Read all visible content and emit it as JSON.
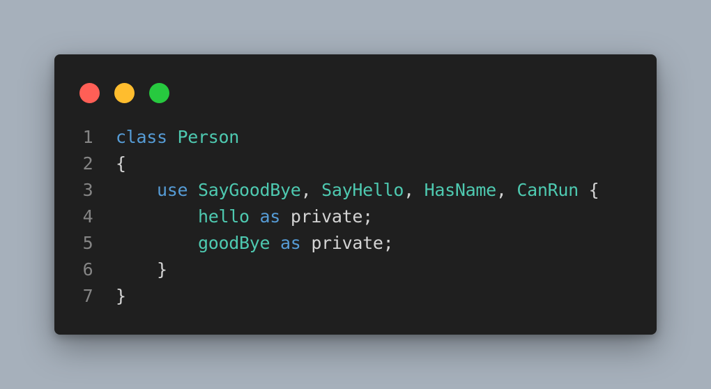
{
  "colors": {
    "background": "#a6b0bb",
    "editor_background": "#1f1f1f",
    "keyword": "#569cd6",
    "type": "#4ec9b0",
    "plain": "#d4d4d4",
    "line_number": "#858585",
    "dot_red": "#ff5f56",
    "dot_yellow": "#ffbd2e",
    "dot_green": "#27c93f"
  },
  "window_controls": [
    {
      "name": "close",
      "icon": "red-dot-icon"
    },
    {
      "name": "minimize",
      "icon": "yellow-dot-icon"
    },
    {
      "name": "maximize",
      "icon": "green-dot-icon"
    }
  ],
  "code": {
    "lines": [
      {
        "number": "1",
        "tokens": [
          {
            "text": "class",
            "kind": "kw"
          },
          {
            "text": " ",
            "kind": "pl"
          },
          {
            "text": "Person",
            "kind": "ty"
          }
        ]
      },
      {
        "number": "2",
        "tokens": [
          {
            "text": "{",
            "kind": "pl"
          }
        ]
      },
      {
        "number": "3",
        "tokens": [
          {
            "text": "    ",
            "kind": "pl"
          },
          {
            "text": "use",
            "kind": "kw"
          },
          {
            "text": " ",
            "kind": "pl"
          },
          {
            "text": "SayGoodBye",
            "kind": "ty"
          },
          {
            "text": ", ",
            "kind": "pl"
          },
          {
            "text": "SayHello",
            "kind": "ty"
          },
          {
            "text": ", ",
            "kind": "pl"
          },
          {
            "text": "HasName",
            "kind": "ty"
          },
          {
            "text": ", ",
            "kind": "pl"
          },
          {
            "text": "CanRun",
            "kind": "ty"
          },
          {
            "text": " {",
            "kind": "pl"
          }
        ]
      },
      {
        "number": "4",
        "tokens": [
          {
            "text": "        ",
            "kind": "pl"
          },
          {
            "text": "hello",
            "kind": "ty"
          },
          {
            "text": " ",
            "kind": "pl"
          },
          {
            "text": "as",
            "kind": "kw"
          },
          {
            "text": " private;",
            "kind": "pl"
          }
        ]
      },
      {
        "number": "5",
        "tokens": [
          {
            "text": "        ",
            "kind": "pl"
          },
          {
            "text": "goodBye",
            "kind": "ty"
          },
          {
            "text": " ",
            "kind": "pl"
          },
          {
            "text": "as",
            "kind": "kw"
          },
          {
            "text": " private;",
            "kind": "pl"
          }
        ]
      },
      {
        "number": "6",
        "tokens": [
          {
            "text": "    ",
            "kind": "pl"
          },
          {
            "text": "}",
            "kind": "pl"
          }
        ]
      },
      {
        "number": "7",
        "tokens": [
          {
            "text": "}",
            "kind": "pl"
          }
        ]
      }
    ]
  }
}
